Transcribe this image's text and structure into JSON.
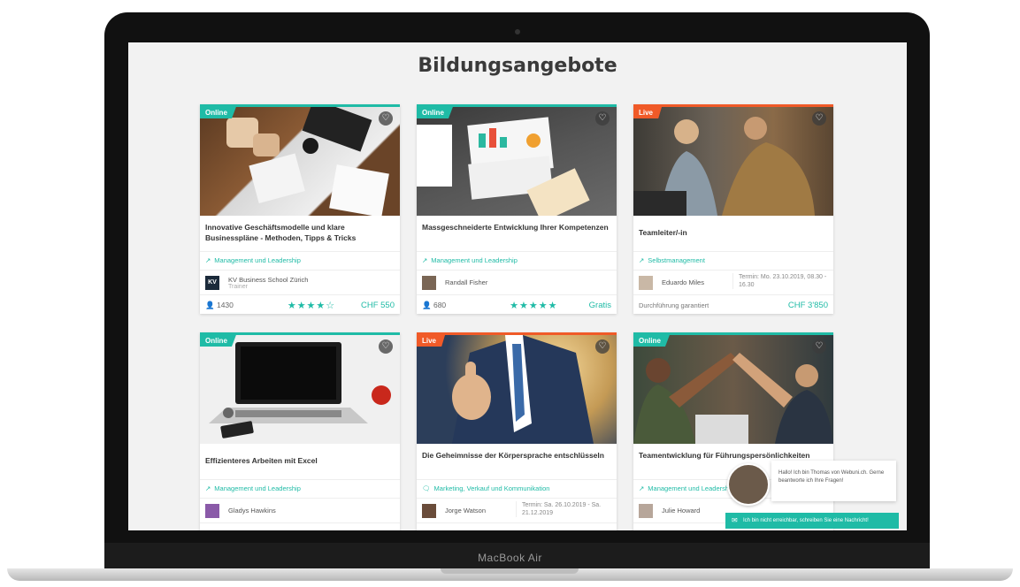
{
  "device": {
    "label": "MacBook Air"
  },
  "page": {
    "title": "Bildungsangebote"
  },
  "colors": {
    "accent": "#1fbba6",
    "live": "#f05a28"
  },
  "cards": [
    {
      "badge": "Online",
      "title": "Innovative Geschäftsmodelle und klare Businesspläne - Methoden, Tipps & Tricks",
      "category": "Management und Leadership",
      "trainer": "KV Business School Zürich",
      "trainer_role": "Trainer",
      "count": "1430",
      "rating_stars": 4,
      "price": "CHF 550",
      "avatar_text": "KV"
    },
    {
      "badge": "Online",
      "title": "Massgeschneiderte Entwicklung Ihrer Kompetenzen",
      "category": "Management und Leadership",
      "trainer": "Randall Fisher",
      "count": "680",
      "rating_stars": 5,
      "price": "Gratis"
    },
    {
      "badge": "Live",
      "title": "Teamleiter/-in",
      "category": "Selbstmanagement",
      "trainer": "Eduardo Miles",
      "termin": "Termin: Mo. 23.10.2019, 08.30 - 16.30",
      "guarantee": "Durchführung garantiert",
      "price": "CHF 3'850"
    },
    {
      "badge": "Online",
      "title": "Effizienteres Arbeiten mit Excel",
      "category": "Management und Leadership",
      "trainer": "Gladys Hawkins"
    },
    {
      "badge": "Live",
      "title": "Die Geheimnisse der Körpersprache entschlüsseln",
      "category": "Marketing, Verkauf und Kommunikation",
      "trainer": "Jorge Watson",
      "termin": "Termin: Sa. 26.10.2019 - Sa. 21.12.2019"
    },
    {
      "badge": "Online",
      "title": "Teamentwicklung für Führungspersönlichkeiten",
      "category": "Management und Leadership",
      "trainer": "Julie Howard"
    }
  ],
  "chat": {
    "greeting": "Hallo! Ich bin Thomas von Webuni.ch. Gerne beantworte ich Ihre Fragen!",
    "offline_message": "Ich bin nicht erreichbar, schreiben Sie eine Nachricht!"
  }
}
